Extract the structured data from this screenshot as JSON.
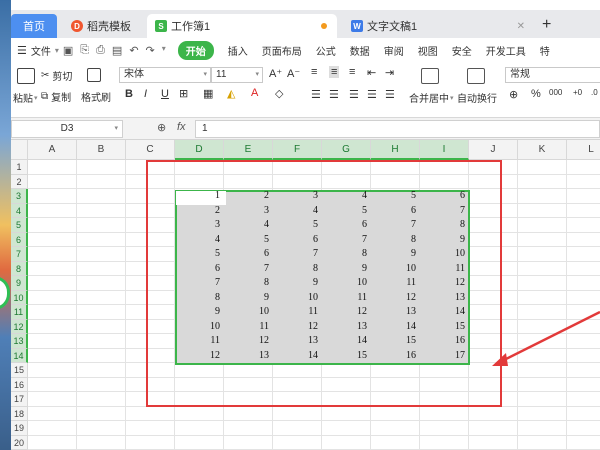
{
  "tabs": {
    "home": "首页",
    "template": "稻壳模板",
    "workbook": "工作簿1",
    "document": "文字文稿1",
    "add": "+"
  },
  "menu": {
    "file": "文件",
    "items": [
      "开始",
      "插入",
      "页面布局",
      "公式",
      "数据",
      "审阅",
      "视图",
      "安全",
      "开发工具",
      "特"
    ]
  },
  "ribbon": {
    "paste": "粘贴",
    "cut": "剪切",
    "copy": "复制",
    "format_painter": "格式刷",
    "font_name": "宋体",
    "font_size": "11",
    "merge_center": "合并居中",
    "wrap_text": "自动换行",
    "number_format": "常规",
    "bold": "B",
    "italic": "I",
    "underline": "U",
    "grow_font": "A⁺",
    "shrink_font": "A⁻",
    "percent": "%",
    "thousands": "000"
  },
  "formula_bar": {
    "name_box": "D3",
    "fx": "fx",
    "value": "1"
  },
  "sheet": {
    "columns": [
      "A",
      "B",
      "C",
      "D",
      "E",
      "F",
      "G",
      "H",
      "I",
      "J",
      "K",
      "L"
    ],
    "rows": [
      "1",
      "2",
      "3",
      "4",
      "5",
      "6",
      "7",
      "8",
      "9",
      "10",
      "11",
      "12",
      "13",
      "14",
      "15",
      "16",
      "17",
      "18",
      "19",
      "20"
    ],
    "selected_columns": [
      "D",
      "E",
      "F",
      "G",
      "H",
      "I"
    ],
    "selected_rows": [
      "3",
      "4",
      "5",
      "6",
      "7",
      "8",
      "9",
      "10",
      "11",
      "12",
      "13",
      "14"
    ],
    "data": [
      [
        1,
        2,
        3,
        4,
        5,
        6
      ],
      [
        2,
        3,
        4,
        5,
        6,
        7
      ],
      [
        3,
        4,
        5,
        6,
        7,
        8
      ],
      [
        4,
        5,
        6,
        7,
        8,
        9
      ],
      [
        5,
        6,
        7,
        8,
        9,
        10
      ],
      [
        6,
        7,
        8,
        9,
        10,
        11
      ],
      [
        7,
        8,
        9,
        10,
        11,
        12
      ],
      [
        8,
        9,
        10,
        11,
        12,
        13
      ],
      [
        9,
        10,
        11,
        12,
        13,
        14
      ],
      [
        10,
        11,
        12,
        13,
        14,
        15
      ],
      [
        11,
        12,
        13,
        14,
        15,
        16
      ],
      [
        12,
        13,
        14,
        15,
        16,
        17
      ]
    ]
  },
  "colors": {
    "accent_green": "#3cb54a",
    "annotation_red": "#e23a3a",
    "selection_fill": "#d9d9d9"
  }
}
